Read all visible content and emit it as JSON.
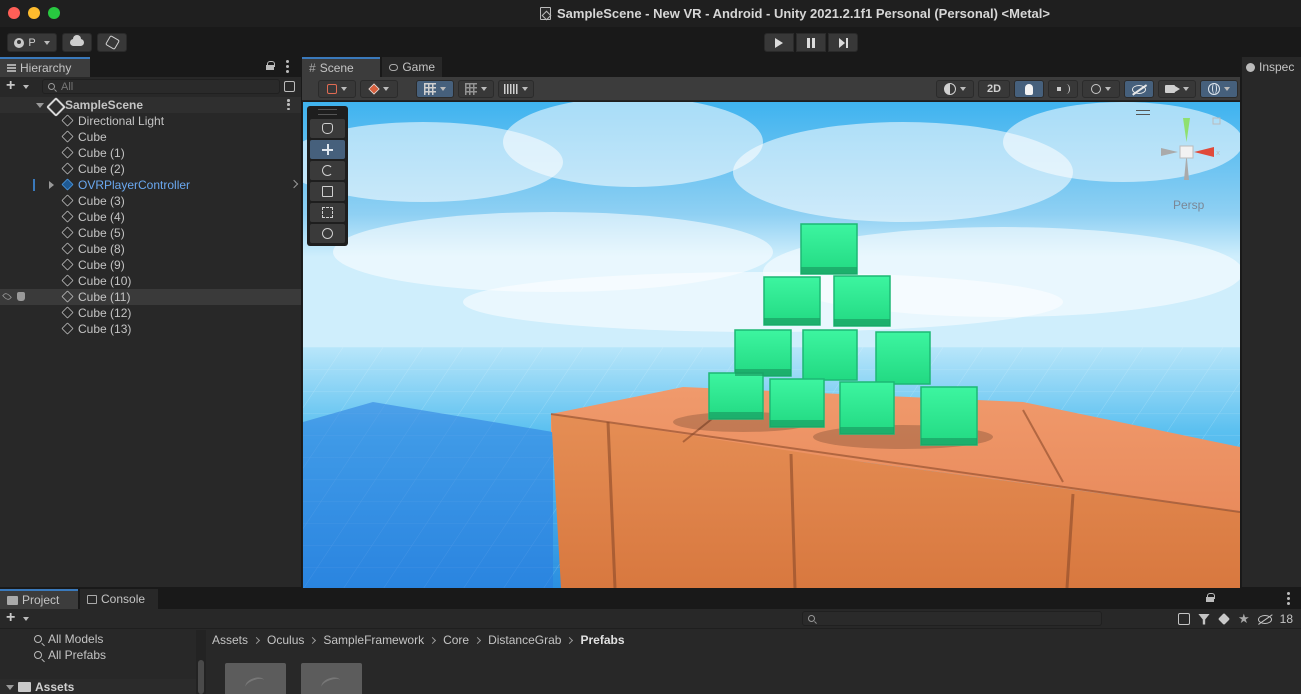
{
  "window": {
    "title": "SampleScene - New VR - Android - Unity 2021.2.1f1 Personal (Personal) <Metal>"
  },
  "toolbar": {
    "account_label": "P",
    "play_icon": "play-icon",
    "pause_icon": "pause-icon",
    "step_icon": "step-icon"
  },
  "hierarchy": {
    "tab_label": "Hierarchy",
    "search_placeholder": "All",
    "scene_name": "SampleScene",
    "items": [
      {
        "label": "Directional Light"
      },
      {
        "label": "Cube"
      },
      {
        "label": "Cube (1)"
      },
      {
        "label": "Cube (2)"
      },
      {
        "label": "OVRPlayerController",
        "prefab": true
      },
      {
        "label": "Cube (3)"
      },
      {
        "label": "Cube (4)"
      },
      {
        "label": "Cube (5)"
      },
      {
        "label": "Cube (8)"
      },
      {
        "label": "Cube (9)"
      },
      {
        "label": "Cube (10)"
      },
      {
        "label": "Cube (11)",
        "selected": true
      },
      {
        "label": "Cube (12)"
      },
      {
        "label": "Cube (13)"
      }
    ]
  },
  "scene": {
    "tabs": [
      {
        "label": "Scene",
        "active": true
      },
      {
        "label": "Game",
        "active": false
      }
    ],
    "toggle_2d": "2D",
    "gizmo_label": "Persp"
  },
  "inspector": {
    "tab_label": "Inspec"
  },
  "project": {
    "tabs": [
      {
        "label": "Project",
        "active": true
      },
      {
        "label": "Console",
        "active": false
      }
    ],
    "favorites": [
      {
        "label": "All Models"
      },
      {
        "label": "All Prefabs"
      }
    ],
    "assets_label": "Assets",
    "breadcrumbs": [
      "Assets",
      "Oculus",
      "SampleFramework",
      "Core",
      "DistanceGrab",
      "Prefabs"
    ],
    "hidden_count": "18"
  },
  "colors": {
    "accent": "#3a79bb",
    "prefab_blue": "#6aa8f0",
    "cube_green": "#2ee58f",
    "platform_orange": "#e08a57"
  }
}
